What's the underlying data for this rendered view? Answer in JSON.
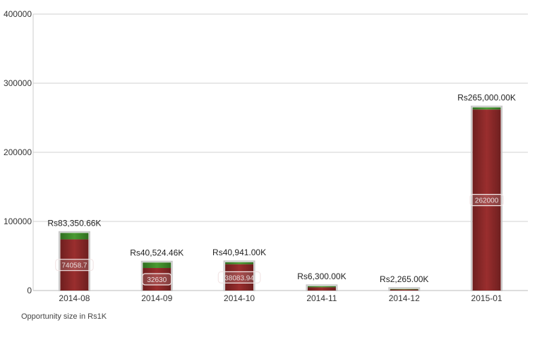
{
  "chart_data": {
    "type": "bar",
    "stacked": true,
    "categories": [
      "2014-08",
      "2014-09",
      "2014-10",
      "2014-11",
      "2014-12",
      "2015-01"
    ],
    "series": [
      {
        "values": [
          74058.7,
          32630,
          38083.94,
          4700,
          1500,
          262000
        ],
        "color": "#8b2a2a"
      },
      {
        "values": [
          9292,
          7894.5,
          2857,
          1600,
          765,
          3000
        ],
        "color": "#3e8a2a"
      }
    ],
    "total_labels": [
      "Rs83,350.66K",
      "Rs40,524.46K",
      "Rs40,941.00K",
      "Rs6,300.00K",
      "Rs2,265.00K",
      "Rs265,000.00K"
    ],
    "inner_labels": [
      "74058.7",
      "32630",
      "38083.94",
      "",
      "",
      "262000"
    ],
    "yticks": [
      "0",
      "100000",
      "200000",
      "300000",
      "400000"
    ],
    "ylim": [
      0,
      400000
    ],
    "grid": true,
    "footnote": "Opportunity size in Rs1K"
  }
}
